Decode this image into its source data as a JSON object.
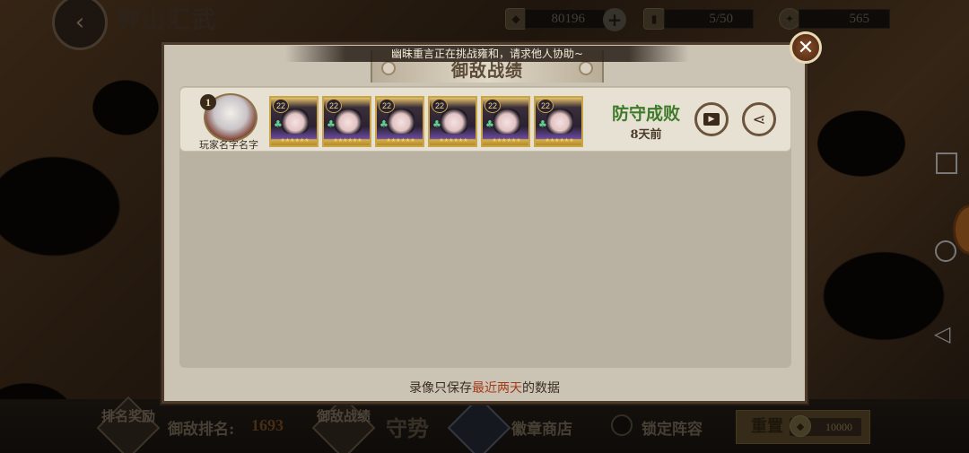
{
  "header": {
    "back_icon": "chevron-left-icon",
    "title": "钟山汇武",
    "resources": [
      {
        "icon": "coin-icon",
        "value": "80196"
      },
      {
        "icon": "ticket-icon",
        "value": "5/50"
      },
      {
        "icon": "gem-icon",
        "value": "565"
      }
    ]
  },
  "dialog": {
    "title": "御敌战绩",
    "help_banner": "幽昧重言正在挑战雍和，请求他人协助~",
    "record": {
      "rank": "1",
      "player_name": "玩家名字名字",
      "heroes": [
        {
          "level": "22",
          "stars": "★★★★★★"
        },
        {
          "level": "22",
          "stars": "★★★★★★"
        },
        {
          "level": "22",
          "stars": "★★★★★★"
        },
        {
          "level": "22",
          "stars": "★★★★★★"
        },
        {
          "level": "22",
          "stars": "★★★★★★"
        },
        {
          "level": "22",
          "stars": "★★★★★★"
        }
      ],
      "result": "防守成败",
      "time": "8天前",
      "result_color": "#3f7a2a"
    },
    "footer_prefix": "录像只保存",
    "footer_highlight": "最近两天",
    "footer_suffix": "的数据"
  },
  "bottom_bar": {
    "rank_reward_label": "排名奖励",
    "defense_rank_label": "御敌排名:",
    "defense_rank_value": "1693",
    "defense_record_label": "御敌战绩",
    "guard_label": "守势",
    "badge_shop_label": "徽章商店",
    "lock_label": "锁定阵容",
    "reset_label": "重置",
    "reset_cost": "10000"
  }
}
